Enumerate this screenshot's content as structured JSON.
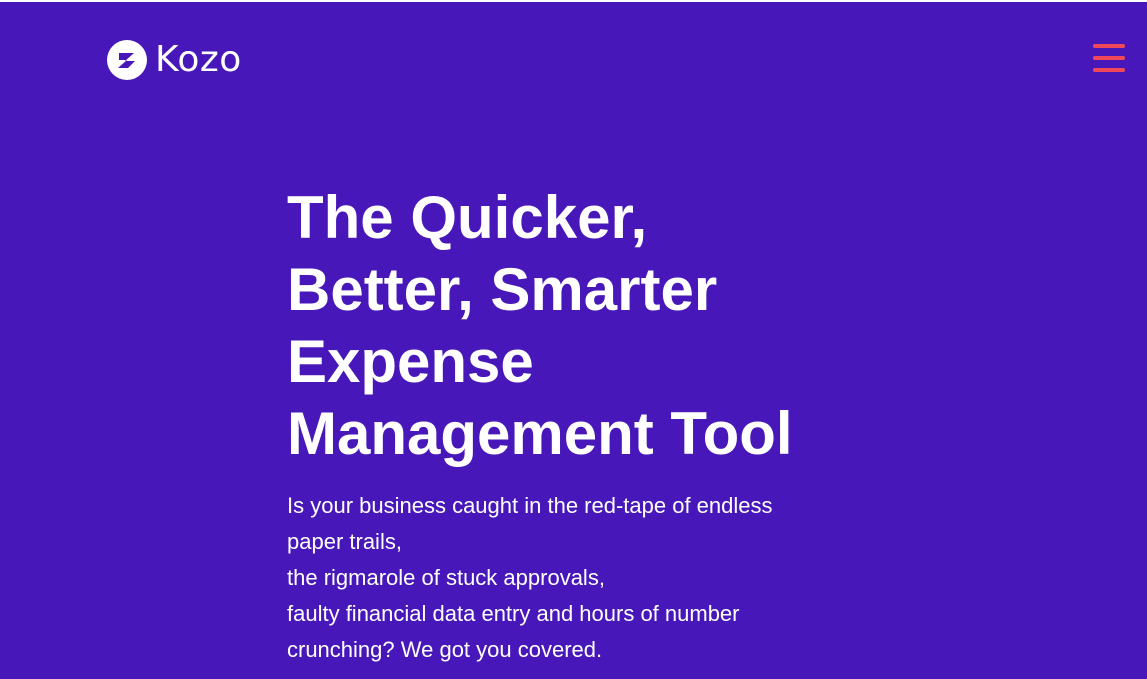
{
  "brand": {
    "name": "Kozo",
    "logo_icon": "kozo-logo-icon"
  },
  "header": {
    "menu_icon": "hamburger-menu-icon"
  },
  "hero": {
    "title_lines": [
      "The Quicker,",
      "Better, Smarter",
      "Expense",
      "Management Tool"
    ],
    "description_lines": [
      "Is your business caught in the red-tape of endless",
      "paper trails,",
      "the rigmarole of stuck approvals,",
      "faulty financial data entry and hours of number",
      "crunching? We got you covered."
    ]
  },
  "colors": {
    "background": "#4717b9",
    "text": "#ffffff",
    "menu_accent": "#f04858"
  }
}
